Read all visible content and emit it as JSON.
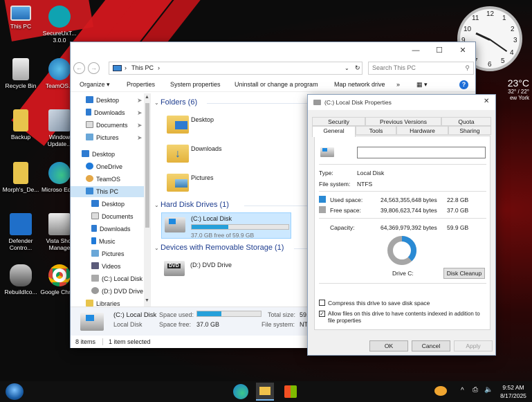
{
  "desktop": {
    "icons": [
      {
        "name": "this-pc-icon",
        "label": "This PC"
      },
      {
        "name": "secureux-icon",
        "label": "SecureUxT... 3.0.0"
      },
      {
        "name": "recycle-bin-icon",
        "label": "Recycle Bin"
      },
      {
        "name": "teamos-icon",
        "label": "TeamOS..."
      },
      {
        "name": "backup-folder-icon",
        "label": "Backup"
      },
      {
        "name": "windows-update-icon",
        "label": "Window Update..."
      },
      {
        "name": "morphs-folder-icon",
        "label": "Morph's_De..."
      },
      {
        "name": "edge-icon",
        "label": "Microso Edge"
      },
      {
        "name": "defender-icon",
        "label": "Defender Contro..."
      },
      {
        "name": "vista-shortcut-icon",
        "label": "Vista Shor Manage"
      },
      {
        "name": "rebuildicons-icon",
        "label": "RebuildIco..."
      },
      {
        "name": "chrome-icon",
        "label": "Google Chrom"
      }
    ],
    "weather": {
      "temp": "23°C",
      "range": "32° / 22°",
      "city": "ew York"
    },
    "clock_numbers": [
      "12",
      "1",
      "2",
      "3",
      "4",
      "5",
      "6",
      "7",
      "8",
      "9",
      "10",
      "11"
    ]
  },
  "explorer": {
    "window_controls": {
      "minimize": "—",
      "maximize": "☐",
      "close": "✕"
    },
    "address": {
      "location": "This PC",
      "separator": "›"
    },
    "search": {
      "placeholder": "Search This PC"
    },
    "commands": [
      "Organize ▾",
      "Properties",
      "System properties",
      "Uninstall or change a program",
      "Map network drive",
      "»"
    ],
    "nav": [
      {
        "label": "Desktop",
        "pinned": true
      },
      {
        "label": "Downloads",
        "pinned": true
      },
      {
        "label": "Documents",
        "pinned": true
      },
      {
        "label": "Pictures",
        "pinned": true
      },
      {
        "label": "Desktop",
        "pinned": false
      },
      {
        "label": "OneDrive",
        "pinned": false
      },
      {
        "label": "TeamOS",
        "pinned": false
      },
      {
        "label": "This PC",
        "pinned": false
      },
      {
        "label": "Desktop",
        "pinned": false
      },
      {
        "label": "Documents",
        "pinned": false
      },
      {
        "label": "Downloads",
        "pinned": false
      },
      {
        "label": "Music",
        "pinned": false
      },
      {
        "label": "Pictures",
        "pinned": false
      },
      {
        "label": "Videos",
        "pinned": false
      },
      {
        "label": "(C:) Local Disk",
        "pinned": false
      },
      {
        "label": "(D:) DVD Drive",
        "pinned": false
      },
      {
        "label": "Libraries",
        "pinned": false
      }
    ],
    "groups": {
      "folders": "Folders (6)",
      "hard_disks": "Hard Disk Drives (1)",
      "removable": "Devices with Removable Storage (1)"
    },
    "folders": [
      "Desktop",
      "Downloads",
      "Pictures"
    ],
    "drive_c": {
      "name": "(C:) Local Disk",
      "free_text": "37.0 GB free of 59.9 GB",
      "used_fraction": 0.38
    },
    "drive_d": {
      "name": "(D:) DVD Drive",
      "badge": "DVD"
    },
    "details": {
      "name": "(C:) Local Disk",
      "type": "Local Disk",
      "space_used_label": "Space used:",
      "space_free_label": "Space free:",
      "space_free": "37.0 GB",
      "total_size_label": "Total size:",
      "total_size": "59.",
      "fs_label": "File system:",
      "fs": "NT"
    },
    "status": {
      "items": "8 items",
      "selected": "1 item selected"
    }
  },
  "properties": {
    "title": "(C:) Local Disk Properties",
    "tabs_row1": [
      "Security",
      "Previous Versions",
      "Quota"
    ],
    "tabs_row2": [
      "General",
      "Tools",
      "Hardware",
      "Sharing"
    ],
    "name_value": "",
    "type_label": "Type:",
    "type_value": "Local Disk",
    "fs_label": "File system:",
    "fs_value": "NTFS",
    "used_label": "Used space:",
    "used_bytes": "24,563,355,648 bytes",
    "used_gb": "22.8 GB",
    "free_label": "Free space:",
    "free_bytes": "39,806,623,744 bytes",
    "free_gb": "37.0 GB",
    "capacity_label": "Capacity:",
    "capacity_bytes": "64,369,979,392 bytes",
    "capacity_gb": "59.9 GB",
    "drive_label": "Drive C:",
    "cleanup_button": "Disk Cleanup",
    "used_fraction": 0.38,
    "compress_label": "Compress this drive to save disk space",
    "compress_checked": false,
    "index_label_1": "Allow files on this drive to have contents indexed in addition to",
    "index_label_2": "file properties",
    "index_checked": true,
    "ok": "OK",
    "cancel": "Cancel",
    "apply": "Apply",
    "colors": {
      "used": "#2a8ad4",
      "free": "#a6a6a6"
    }
  },
  "taskbar": {
    "time": "9:52 AM",
    "date": "8/17/2025",
    "tray": [
      "^",
      "⎙",
      "🔈"
    ]
  }
}
